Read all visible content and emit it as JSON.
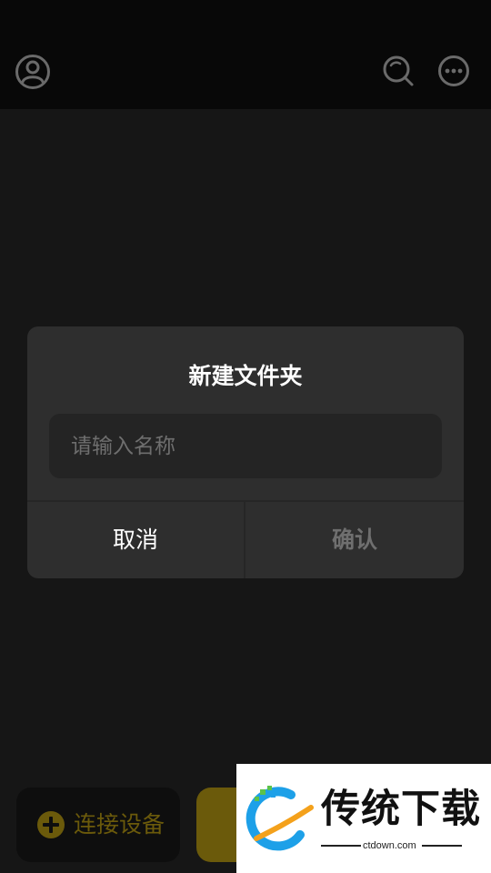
{
  "header": {
    "avatar_icon": "user-circle-icon",
    "search_icon": "search-icon",
    "more_icon": "more-horizontal-icon"
  },
  "dialog": {
    "title": "新建文件夹",
    "input_placeholder": "请输入名称",
    "input_value": "",
    "cancel_label": "取消",
    "confirm_label": "确认"
  },
  "bottom": {
    "connect_label": "连接设备",
    "connect_icon": "plus-circle-icon"
  },
  "watermark": {
    "title": "传统下载",
    "url": "ctdown.com"
  },
  "colors": {
    "accent": "#6b5a0b",
    "background": "#161616",
    "dialog": "#2e2e2e"
  }
}
